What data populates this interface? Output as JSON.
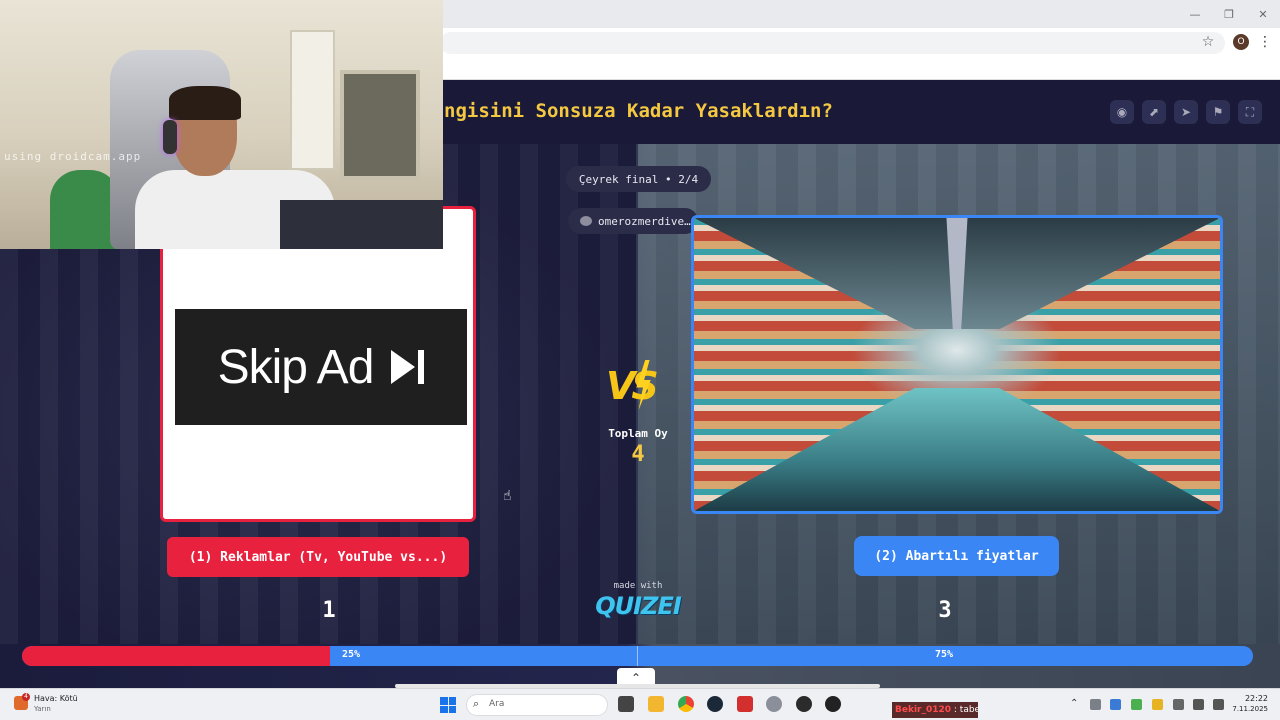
{
  "browser": {
    "window_buttons": [
      "—",
      "❐",
      "✕"
    ],
    "profile_initial": "O"
  },
  "header": {
    "title": "ngisini Sonsuza Kadar Yasaklardın?"
  },
  "round": {
    "label": "Çeyrek final • 2/4"
  },
  "creator": {
    "name": "omerozmerdive…"
  },
  "left_option": {
    "image_text": "Skip Ad",
    "label": "(1) Reklamlar (Tv, YouTube vs...)",
    "votes": "1",
    "percent": "25%",
    "share": 0.25,
    "color": "#e8223e"
  },
  "right_option": {
    "label": "(2) Abartılı fiyatlar",
    "votes": "3",
    "percent": "75%",
    "share": 0.75,
    "color": "#3a86f5"
  },
  "center": {
    "vs_label": "VS",
    "total_label": "Toplam Oy",
    "total_value": "4",
    "made_with": "made with",
    "brand": "QUIZEI"
  },
  "webcam": {
    "watermark": "using droidcam.app"
  },
  "taskbar": {
    "weather_badge": "4",
    "weather_title": "Hava: Kötü",
    "weather_subtitle": "Yarın",
    "search_placeholder": "Ara",
    "stream_user": "Bekir_0120",
    "stream_message": " : tabe",
    "clock_time": "22:22",
    "clock_date": "7.11.2025"
  }
}
